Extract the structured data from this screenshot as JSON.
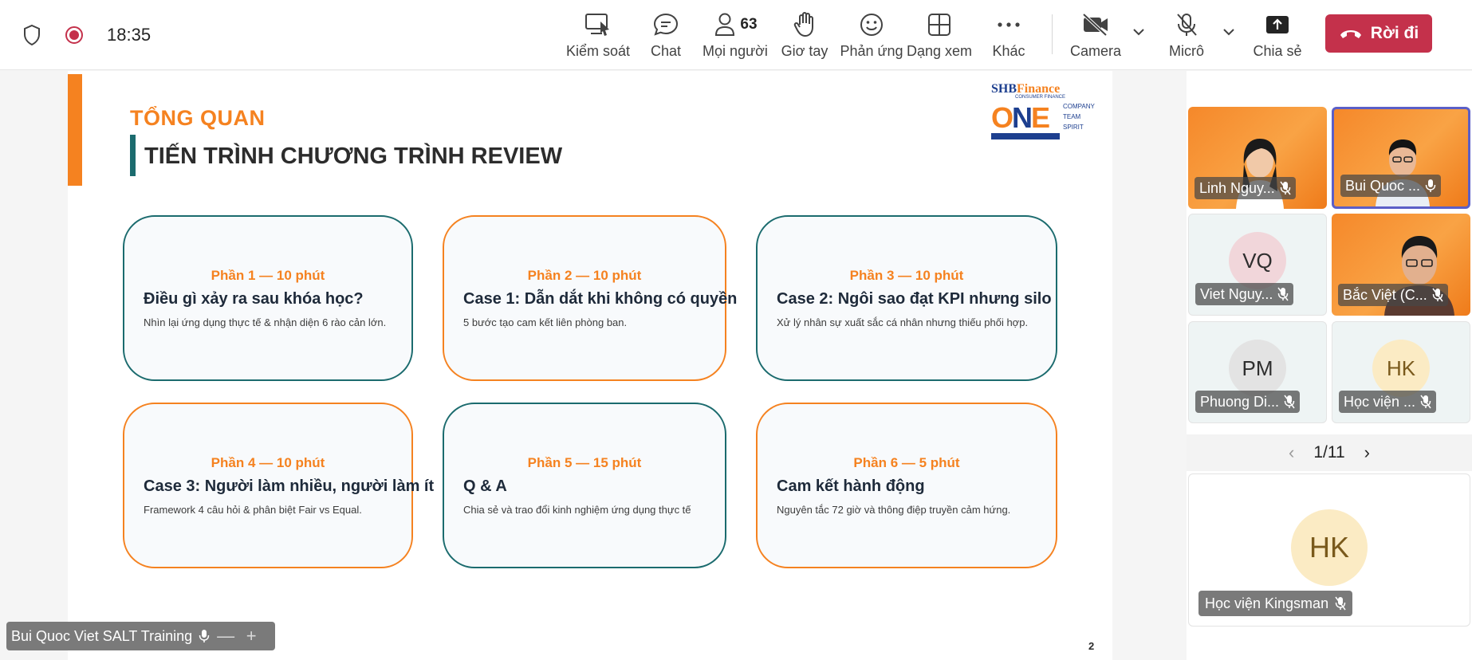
{
  "topbar": {
    "clock": "18:35",
    "buttons": {
      "control": "Kiểm soát",
      "chat": "Chat",
      "people": "Mọi người",
      "people_count": "63",
      "raise_hand": "Giơ tay",
      "react": "Phản ứng",
      "view": "Dạng xem",
      "more": "Khác",
      "camera": "Camera",
      "mic": "Micrô",
      "share": "Chia sẻ"
    },
    "leave": "Rời đi",
    "leave_color": "#c4314b"
  },
  "slide": {
    "eyebrow": "TỔNG QUAN",
    "title": "TIẾN TRÌNH CHƯƠNG TRÌNH REVIEW",
    "logo": {
      "brand_a": "SHB",
      "brand_b": "Finance",
      "brand_sub": "CONSUMER FINANCE",
      "one_a": "O",
      "one_b": "N",
      "one_c": "E",
      "side_1": "COMPANY",
      "side_2": "TEAM",
      "side_3": "SPIRIT"
    },
    "accent_color": "#f58220",
    "teal_color": "#1b6b6e",
    "cards": [
      {
        "part": "Phần 1 — 10 phút",
        "title": "Điều gì xảy ra sau khóa học?",
        "desc": "Nhìn lại ứng dụng thực tế & nhận diện 6 rào cản lớn."
      },
      {
        "part": "Phần 2 — 10 phút",
        "title": "Case 1: Dẫn dắt khi không có quyền",
        "desc": "5 bước tạo cam kết liên phòng ban."
      },
      {
        "part": "Phần 3 — 10 phút",
        "title": "Case 2: Ngôi sao đạt KPI nhưng silo",
        "desc": "Xử lý nhân sự xuất sắc cá nhân nhưng thiếu phối hợp."
      },
      {
        "part": "Phần 4 — 10 phút",
        "title": "Case 3: Người làm nhiều, người làm ít",
        "desc": "Framework 4 câu hỏi & phân biệt Fair vs Equal."
      },
      {
        "part": "Phần 5 — 15 phút",
        "title": "Q & A",
        "desc": "Chia sẻ và trao đổi kinh nghiệm ứng dụng thực tế"
      },
      {
        "part": "Phần 6 — 5 phút",
        "title": "Cam kết hành động",
        "desc": "Nguyên tắc 72 giờ và thông điệp truyền cảm hứng."
      }
    ],
    "page_number": "2"
  },
  "presenter": {
    "name": "Bui Quoc Viet SALT Training",
    "minus": "—",
    "plus": "+"
  },
  "participants": {
    "tiles": [
      {
        "name": "Linh Nguy...",
        "type": "video"
      },
      {
        "name": "Bui Quoc ...",
        "type": "video"
      },
      {
        "name": "Viet Nguy...",
        "initials": "VQ",
        "avatar_color": "#f1d6da"
      },
      {
        "name": "Bắc Việt (C...",
        "type": "video"
      },
      {
        "name": "Phuong Di...",
        "initials": "PM",
        "avatar_color": "#e3e3e3"
      },
      {
        "name": "Học viện ...",
        "initials": "HK",
        "avatar_color": "#fbebc4"
      }
    ],
    "pager": "1/11",
    "featured": {
      "name": "Học viện Kingsman",
      "initials": "HK"
    }
  }
}
